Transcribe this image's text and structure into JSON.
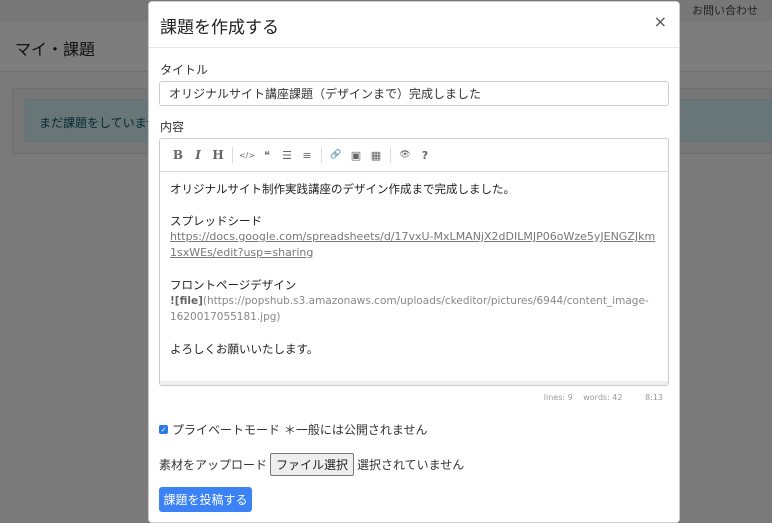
{
  "background": {
    "top_links": [
      "お問い合わせ"
    ],
    "page_title": "マイ・課題",
    "alert_text": "まだ課題をしていません"
  },
  "modal": {
    "title": "課題を作成する",
    "close_symbol": "×",
    "title_label": "タイトル",
    "title_value": "オリジナルサイト講座課題（デザインまで）完成しました",
    "content_label": "内容",
    "toolbar": [
      "B",
      "I",
      "H",
      "</>",
      "❝",
      "☰",
      "≡",
      "🔗",
      "▣",
      "▦",
      "👁",
      "?"
    ],
    "content": {
      "line1": "オリジナルサイト制作実践講座のデザイン作成まで完成しました。",
      "sheet_label": "スプレッドシード",
      "sheet_link": "https://docs.google.com/spreadsheets/d/17vxU-MxLMANjX2dDILMJP06oWze5yJENGZJkm1sxWEs/edit?usp=sharing",
      "front_label": "フロントページデザイン",
      "image_prefix": "![file]",
      "image_url": "(https://popshub.s3.amazonaws.com/uploads/ckeditor/pictures/6944/content_image-1620017055181.jpg)",
      "closing": "よろしくお願いいたします。"
    },
    "status": {
      "lines": "lines: 9",
      "words": "words: 42",
      "cursor": "8:13"
    },
    "private_label": "プライベートモード ＊一般には公開されません",
    "upload_label": "素材をアップロード",
    "file_button": "ファイル選択",
    "file_status": "選択されていません",
    "submit_label": "課題を投稿する"
  }
}
